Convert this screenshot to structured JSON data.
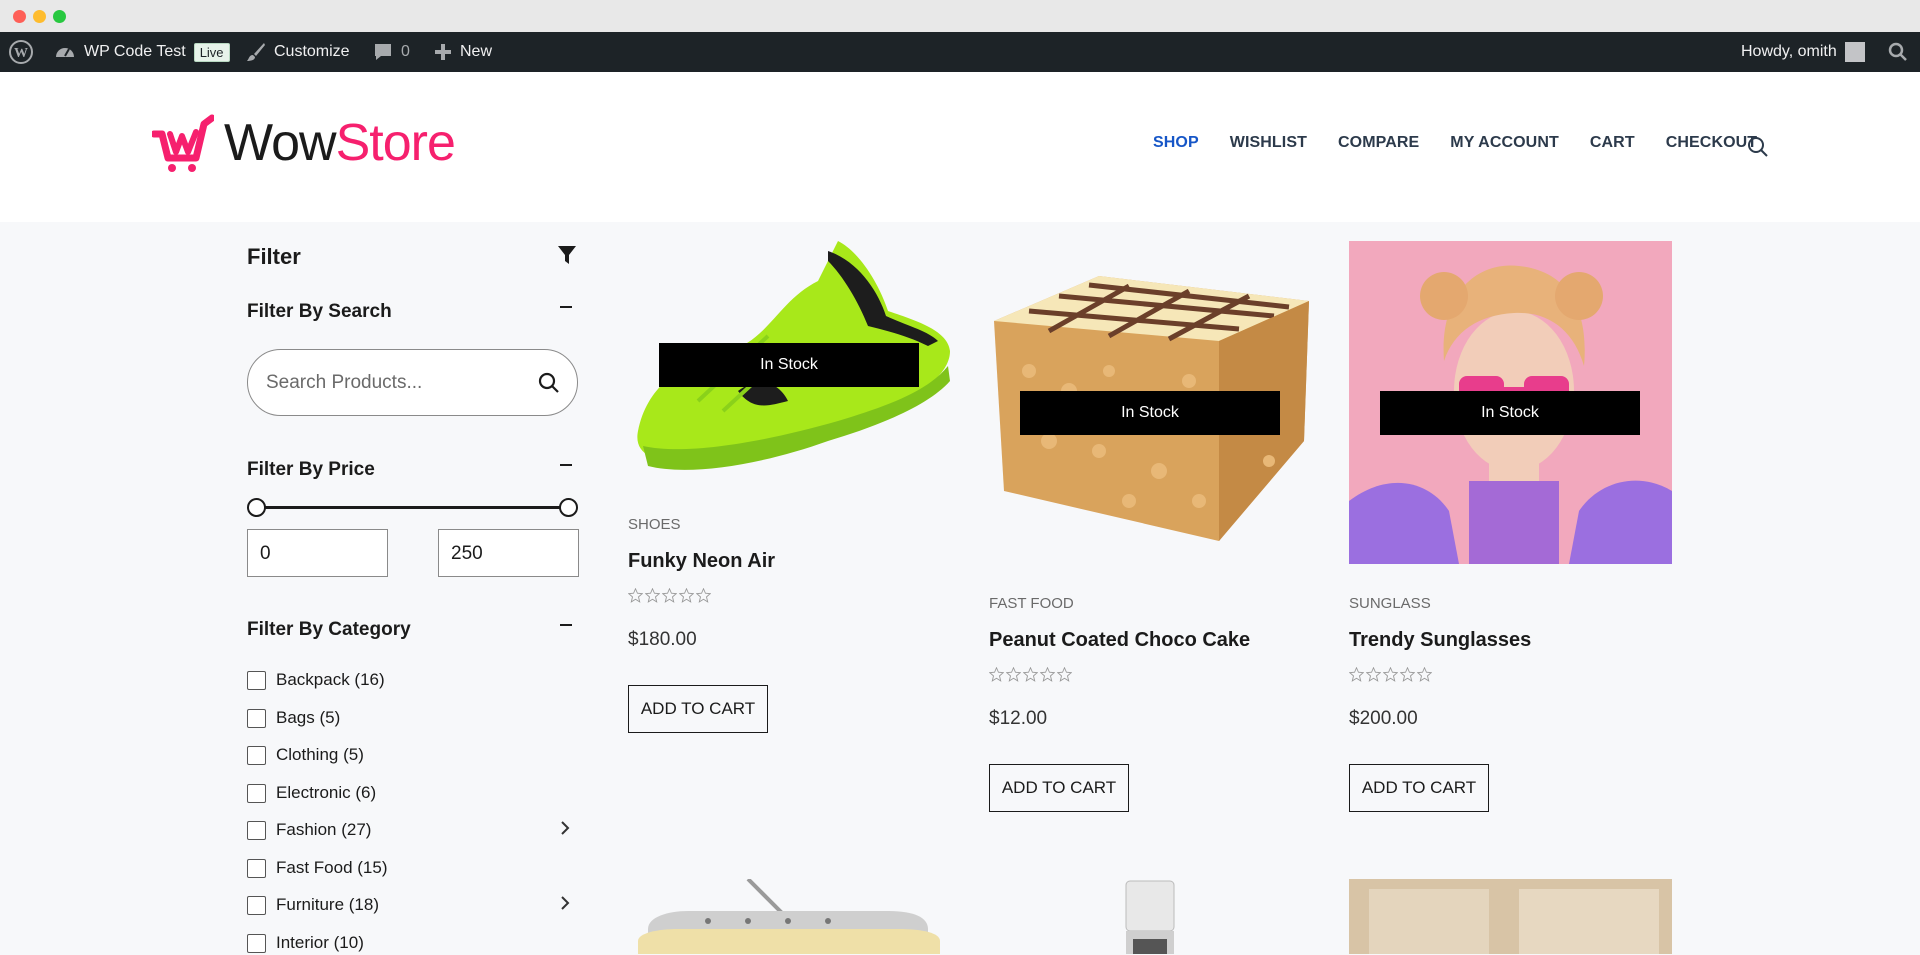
{
  "adminbar": {
    "site_name": "WP Code Test",
    "live_badge": "Live",
    "customize": "Customize",
    "comments_count": "0",
    "new_label": "New",
    "howdy": "Howdy, omith"
  },
  "header": {
    "logo_wow": "Wow",
    "logo_store": "Store",
    "nav": [
      "SHOP",
      "WISHLIST",
      "COMPARE",
      "MY ACCOUNT",
      "CART",
      "CHECKOUT"
    ],
    "active_nav": "SHOP",
    "brand_color": "#f6206e",
    "active_nav_color": "#1656c7"
  },
  "filter": {
    "title": "Filter",
    "search_section": "Filter By Search",
    "search_placeholder": "Search Products...",
    "price_section": "Filter By Price",
    "price_min": "0",
    "price_max": "250",
    "category_section": "Filter By Category",
    "categories": [
      {
        "label": "Backpack (16)",
        "has_children": false
      },
      {
        "label": "Bags (5)",
        "has_children": false
      },
      {
        "label": "Clothing (5)",
        "has_children": false
      },
      {
        "label": "Electronic (6)",
        "has_children": false
      },
      {
        "label": "Fashion (27)",
        "has_children": true
      },
      {
        "label": "Fast Food (15)",
        "has_children": false
      },
      {
        "label": "Furniture (18)",
        "has_children": true
      },
      {
        "label": "Interior (10)",
        "has_children": false
      }
    ]
  },
  "products": [
    {
      "category": "SHOES",
      "name": "Funky Neon Air",
      "price": "$180.00",
      "stock": "In Stock",
      "button": "ADD TO CART",
      "rating": 0
    },
    {
      "category": "FAST FOOD",
      "name": "Peanut Coated Choco Cake",
      "price": "$12.00",
      "stock": "In Stock",
      "button": "ADD TO CART",
      "rating": 0
    },
    {
      "category": "SUNGLASS",
      "name": "Trendy Sunglasses",
      "price": "$200.00",
      "stock": "In Stock",
      "button": "ADD TO CART",
      "rating": 0
    }
  ]
}
